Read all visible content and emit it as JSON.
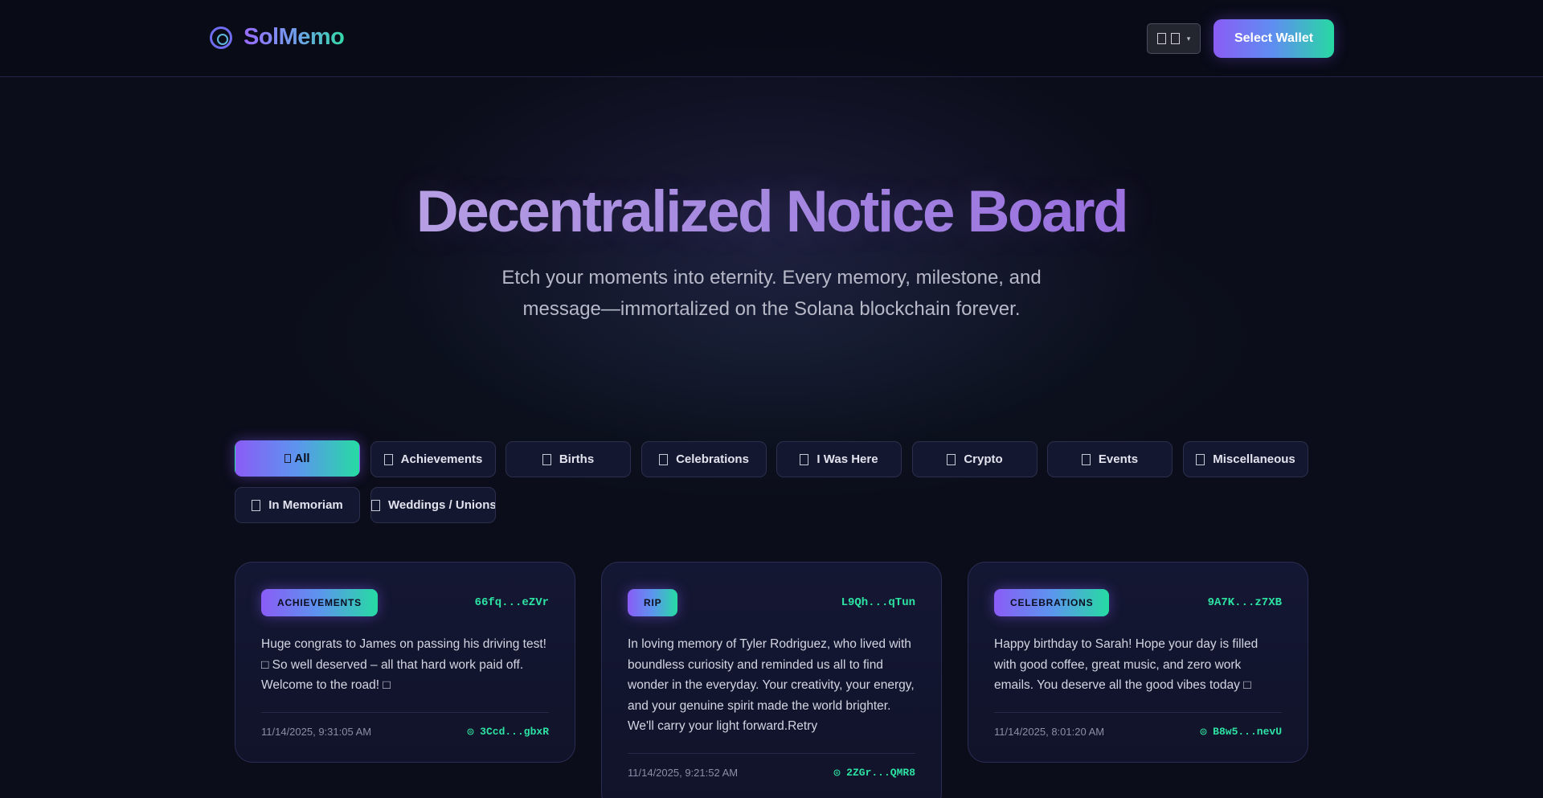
{
  "header": {
    "logo_icon": "ring-logo-icon",
    "brand": "SolMemo",
    "language_icon": "flag-icon",
    "language_caret": "▾",
    "wallet_button": "Select Wallet"
  },
  "hero": {
    "title": "Decentralized Notice Board",
    "subtitle_line1": "Etch your moments into eternity. Every memory, milestone, and",
    "subtitle_line2": "message—immortalized on the Solana blockchain forever."
  },
  "filters": {
    "active": "All",
    "items": [
      {
        "label": "All"
      },
      {
        "label": "Achievements"
      },
      {
        "label": "Births"
      },
      {
        "label": "Celebrations"
      },
      {
        "label": "I Was Here"
      },
      {
        "label": "Crypto"
      },
      {
        "label": "Events"
      },
      {
        "label": "Miscellaneous"
      },
      {
        "label": "In Memoriam"
      },
      {
        "label": "Weddings / Unions"
      }
    ]
  },
  "posts": [
    {
      "category": "ACHIEVEMENTS",
      "signature": "66fq...eZVr",
      "message": "Huge congrats to James on passing his driving test! □ So well deserved – all that hard work paid off. Welcome to the road! □",
      "timestamp": "11/14/2025, 9:31:05 AM",
      "author": "◎ 3Ccd...gbxR"
    },
    {
      "category": "RIP",
      "signature": "L9Qh...qTun",
      "message": "In loving memory of Tyler Rodriguez, who lived with boundless curiosity and reminded us all to find wonder in the everyday. Your creativity, your energy, and your genuine spirit made the world brighter. We'll carry your light forward.Retry",
      "timestamp": "11/14/2025, 9:21:52 AM",
      "author": "◎ 2ZGr...QMR8"
    },
    {
      "category": "CELEBRATIONS",
      "signature": "9A7K...z7XB",
      "message": "Happy birthday to Sarah! Hope your day is filled with good coffee, great music, and zero work emails. You deserve all the good vibes today □",
      "timestamp": "11/14/2025, 8:01:20 AM",
      "author": "◎ B8w5...nevU"
    }
  ],
  "colors": {
    "background": "#0b0d1a",
    "accent_start": "#8a5cf6",
    "accent_end": "#26dba3",
    "address_green": "#2de3a3"
  }
}
